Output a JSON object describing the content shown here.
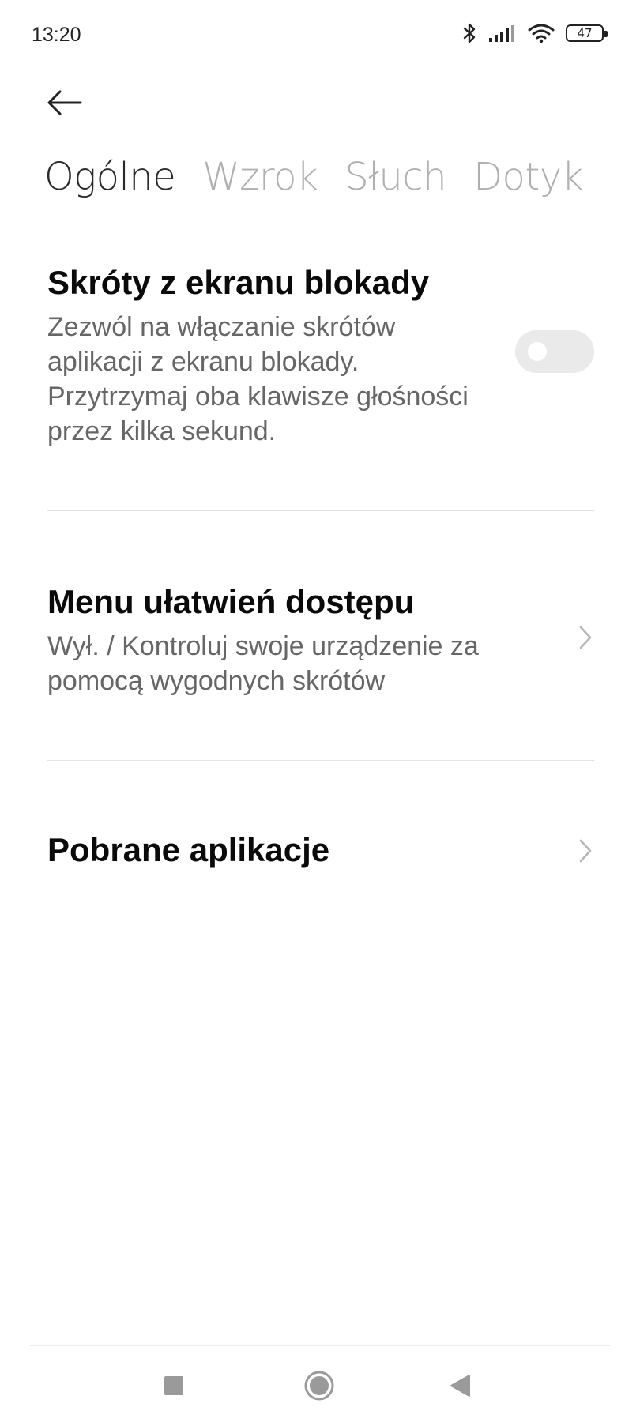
{
  "status_bar": {
    "time": "13:20",
    "battery": "47",
    "icons": [
      "bluetooth-icon",
      "signal-icon",
      "wifi-icon",
      "battery-icon"
    ]
  },
  "header": {
    "back_icon": "arrow-left-icon"
  },
  "tabs": [
    {
      "label": "Ogólne",
      "active": true
    },
    {
      "label": "Wzrok",
      "active": false
    },
    {
      "label": "Słuch",
      "active": false
    },
    {
      "label": "Dotyk",
      "active": false
    }
  ],
  "settings": {
    "lock_screen_shortcut": {
      "title": "Skróty z ekranu blokady",
      "description": "Zezwól na włączanie skrótów aplikacji z ekranu blokady. Przytrzymaj oba klawisze głośności przez kilka sekund.",
      "enabled": false
    },
    "accessibility_menu": {
      "title": "Menu ułatwień dostępu",
      "description": "Wył. / Kontroluj swoje urządzenie za pomocą wygodnych skrótów"
    },
    "downloaded_apps": {
      "title": "Pobrane aplikacje"
    }
  },
  "nav_bar": {
    "icons": [
      "recents-square-icon",
      "home-circle-icon",
      "back-triangle-icon"
    ]
  },
  "colors": {
    "active_tab": "#2a2a2a",
    "inactive_tab": "#b0b0b0",
    "toggle_off": "#eaeaea",
    "divider": "#e3e3e3"
  }
}
